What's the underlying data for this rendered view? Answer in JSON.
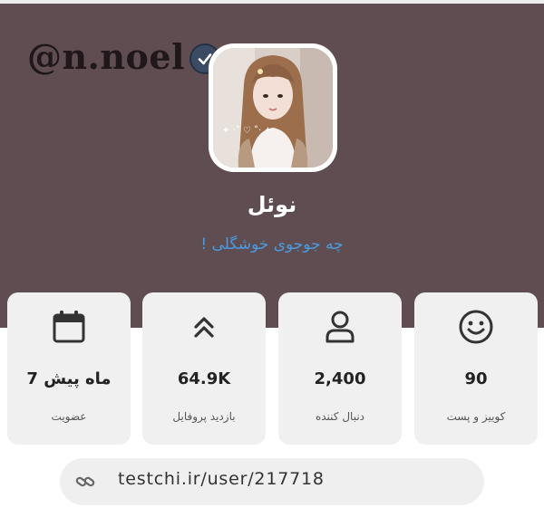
{
  "banner": {
    "handle": "@n.noel"
  },
  "profile": {
    "name": "نوئل",
    "bio": "چه جوجوی خوشگلی !"
  },
  "stats": [
    {
      "icon": "smiley-icon",
      "value": "90",
      "label": "کوییز و پست"
    },
    {
      "icon": "person-icon",
      "value": "2,400",
      "label": "دنبال کننده"
    },
    {
      "icon": "double-chevron-up-icon",
      "value": "64.9K",
      "label": "بازدید پروفایل"
    },
    {
      "icon": "calendar-icon",
      "value": "7 ماه پیش",
      "label": "عضویت"
    }
  ],
  "profile_link": {
    "icon": "link-icon",
    "url": "testchi.ir/user/217718"
  },
  "colors": {
    "banner": "#5f4d52",
    "card": "#f0f0f0",
    "bio": "#4a9be0"
  }
}
